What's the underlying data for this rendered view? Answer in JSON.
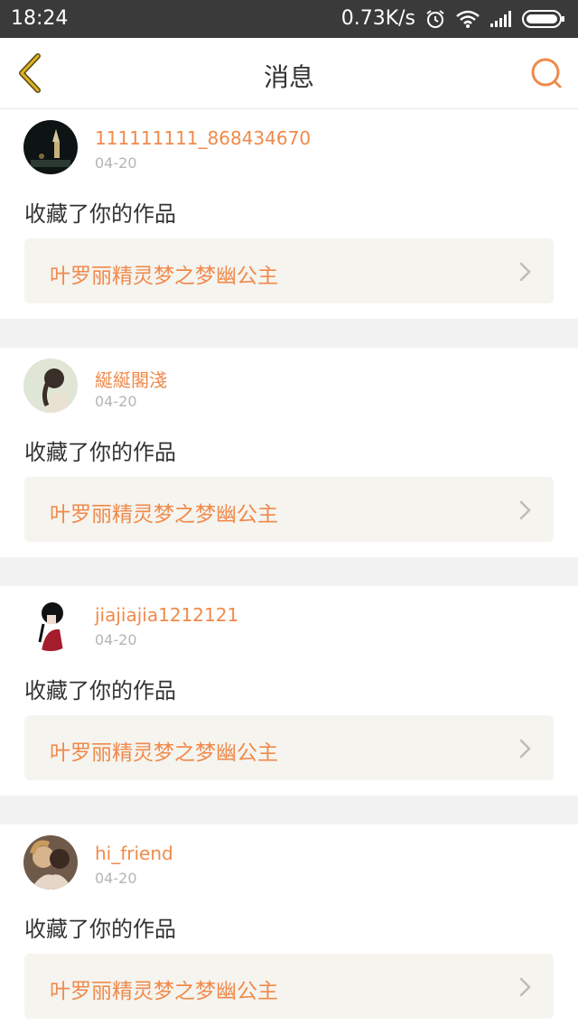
{
  "status_bar": {
    "time": "18:24",
    "network_speed": "0.73K/s"
  },
  "header": {
    "title": "消息",
    "back_icon": "chevron-left-icon",
    "search_icon": "search-icon"
  },
  "colors": {
    "accent": "#f08a4b",
    "back_icon": "#e0b51f",
    "card_link_bg": "#f5f4ef",
    "divider": "#f2f2f2"
  },
  "messages": [
    {
      "username": "111111111_868434670",
      "date": "04-20",
      "action": "收藏了你的作品",
      "work_title": "叶罗丽精灵梦之梦幽公主"
    },
    {
      "username": "綖綖閣淺",
      "date": "04-20",
      "action": "收藏了你的作品",
      "work_title": "叶罗丽精灵梦之梦幽公主"
    },
    {
      "username": "jiajiajia1212121",
      "date": "04-20",
      "action": "收藏了你的作品",
      "work_title": "叶罗丽精灵梦之梦幽公主"
    },
    {
      "username": "hi_friend",
      "date": "04-20",
      "action": "收藏了你的作品",
      "work_title": "叶罗丽精灵梦之梦幽公主"
    }
  ]
}
